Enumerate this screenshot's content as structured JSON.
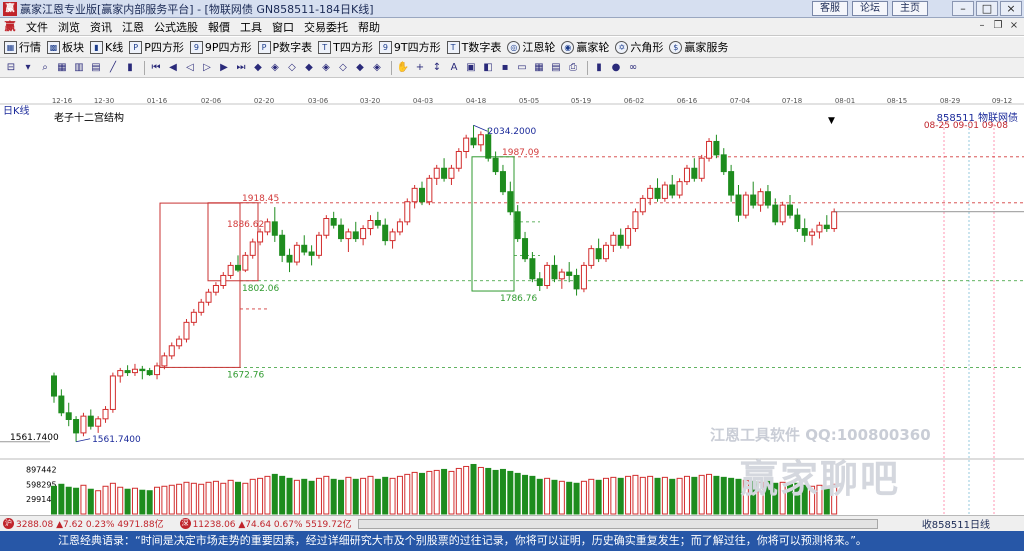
{
  "window": {
    "title": "赢家江恩专业版[赢家内部服务平台] - [物联网债  GN858511-184日K线]",
    "links": [
      "客服",
      "论坛",
      "主页"
    ]
  },
  "menu": [
    "文件",
    "浏览",
    "资讯",
    "江恩",
    "公式选股",
    "報價",
    "工具",
    "窗口",
    "交易委托",
    "帮助"
  ],
  "toolbar": {
    "buttons": [
      {
        "label": "行情",
        "icon": "grid-icon"
      },
      {
        "label": "板块",
        "icon": "blocks-icon"
      },
      {
        "label": "K线",
        "icon": "candle-icon"
      },
      {
        "label": "P四方形",
        "icon": "square-p-icon"
      },
      {
        "label": "9P四方形",
        "icon": "square-9p-icon"
      },
      {
        "label": "P数字表",
        "icon": "table-p-icon"
      },
      {
        "label": "T四方形",
        "icon": "square-t-icon"
      },
      {
        "label": "9T四方形",
        "icon": "square-9t-icon"
      },
      {
        "label": "T数字表",
        "icon": "table-t-icon"
      },
      {
        "label": "江恩轮",
        "icon": "wheel-icon"
      },
      {
        "label": "赢家轮",
        "icon": "winner-wheel-icon"
      },
      {
        "label": "六角形",
        "icon": "hexagon-icon"
      },
      {
        "label": "赢家服务",
        "icon": "dollar-icon"
      }
    ]
  },
  "chart": {
    "period": "日K线",
    "title": "老子十二宫结构",
    "code": "858511  物联网债",
    "future_dates": "08-25 09-01 09-08",
    "watermark": "江恩工具软件  QQ:100800360",
    "watermark_big": "赢家聊吧"
  },
  "chart_data": {
    "type": "candlestick",
    "x_ticks": [
      "12-16",
      "12-30",
      "01-16",
      "02-06",
      "02-20",
      "03-06",
      "03-20",
      "04-03",
      "04-18",
      "05-05",
      "05-19",
      "06-02",
      "06-16",
      "07-04",
      "07-18",
      "08-01",
      "08-15",
      "08-29",
      "09-12"
    ],
    "price_labels": {
      "high": "2034.2000",
      "low": "1561.7400",
      "left_axis": "1561.7400",
      "levels": [
        "1987.09",
        "1918.45",
        "1886.62",
        "1802.06",
        "1786.76",
        "1672.76"
      ]
    },
    "volume_axis_labels": [
      "897442",
      "598295",
      "299147"
    ],
    "ohlc": [
      [
        1660,
        1665,
        1620,
        1630
      ],
      [
        1630,
        1640,
        1600,
        1605
      ],
      [
        1605,
        1620,
        1585,
        1595
      ],
      [
        1595,
        1600,
        1561.74,
        1575
      ],
      [
        1575,
        1605,
        1570,
        1600
      ],
      [
        1600,
        1610,
        1580,
        1585
      ],
      [
        1585,
        1600,
        1575,
        1596
      ],
      [
        1596,
        1615,
        1590,
        1610
      ],
      [
        1610,
        1665,
        1605,
        1660
      ],
      [
        1660,
        1672,
        1650,
        1668
      ],
      [
        1668,
        1676,
        1660,
        1665
      ],
      [
        1665,
        1678,
        1660,
        1670
      ],
      [
        1670,
        1675,
        1655,
        1668
      ],
      [
        1668,
        1672,
        1660,
        1662
      ],
      [
        1662,
        1680,
        1655,
        1675
      ],
      [
        1675,
        1695,
        1670,
        1690
      ],
      [
        1690,
        1710,
        1685,
        1705
      ],
      [
        1705,
        1720,
        1700,
        1715
      ],
      [
        1715,
        1745,
        1710,
        1740
      ],
      [
        1740,
        1760,
        1735,
        1755
      ],
      [
        1755,
        1775,
        1750,
        1770
      ],
      [
        1770,
        1790,
        1765,
        1785
      ],
      [
        1785,
        1800,
        1780,
        1795
      ],
      [
        1795,
        1815,
        1790,
        1810
      ],
      [
        1810,
        1830,
        1805,
        1825
      ],
      [
        1825,
        1840,
        1815,
        1818
      ],
      [
        1818,
        1845,
        1815,
        1840
      ],
      [
        1840,
        1865,
        1835,
        1860
      ],
      [
        1860,
        1880,
        1855,
        1875
      ],
      [
        1875,
        1895,
        1870,
        1890
      ],
      [
        1890,
        1912,
        1860,
        1870
      ],
      [
        1870,
        1878,
        1830,
        1840
      ],
      [
        1840,
        1850,
        1815,
        1830
      ],
      [
        1830,
        1860,
        1825,
        1855
      ],
      [
        1855,
        1870,
        1840,
        1845
      ],
      [
        1845,
        1855,
        1825,
        1840
      ],
      [
        1840,
        1875,
        1835,
        1870
      ],
      [
        1870,
        1900,
        1865,
        1895
      ],
      [
        1895,
        1905,
        1880,
        1885
      ],
      [
        1885,
        1895,
        1860,
        1865
      ],
      [
        1865,
        1880,
        1845,
        1875
      ],
      [
        1875,
        1890,
        1860,
        1865
      ],
      [
        1865,
        1885,
        1855,
        1880
      ],
      [
        1880,
        1900,
        1870,
        1892
      ],
      [
        1892,
        1905,
        1880,
        1885
      ],
      [
        1885,
        1895,
        1855,
        1862
      ],
      [
        1862,
        1880,
        1850,
        1875
      ],
      [
        1875,
        1895,
        1870,
        1890
      ],
      [
        1890,
        1925,
        1885,
        1920
      ],
      [
        1920,
        1945,
        1910,
        1940
      ],
      [
        1940,
        1950,
        1915,
        1920
      ],
      [
        1920,
        1960,
        1915,
        1955
      ],
      [
        1955,
        1975,
        1945,
        1970
      ],
      [
        1970,
        1985,
        1950,
        1955
      ],
      [
        1955,
        1975,
        1945,
        1970
      ],
      [
        1970,
        2000,
        1965,
        1995
      ],
      [
        1995,
        2020,
        1985,
        2015
      ],
      [
        2015,
        2034.2,
        2000,
        2005
      ],
      [
        2005,
        2025,
        1995,
        2020
      ],
      [
        2020,
        2030,
        1980,
        1985
      ],
      [
        1985,
        1995,
        1960,
        1965
      ],
      [
        1965,
        1975,
        1930,
        1935
      ],
      [
        1935,
        1950,
        1900,
        1905
      ],
      [
        1905,
        1915,
        1860,
        1865
      ],
      [
        1865,
        1875,
        1830,
        1835
      ],
      [
        1835,
        1845,
        1800,
        1805
      ],
      [
        1805,
        1815,
        1786.76,
        1795
      ],
      [
        1795,
        1830,
        1790,
        1825
      ],
      [
        1825,
        1840,
        1800,
        1805
      ],
      [
        1805,
        1820,
        1790,
        1815
      ],
      [
        1815,
        1830,
        1800,
        1810
      ],
      [
        1810,
        1820,
        1780,
        1790
      ],
      [
        1790,
        1830,
        1785,
        1825
      ],
      [
        1825,
        1855,
        1820,
        1850
      ],
      [
        1850,
        1865,
        1830,
        1835
      ],
      [
        1835,
        1860,
        1830,
        1855
      ],
      [
        1855,
        1875,
        1845,
        1870
      ],
      [
        1870,
        1880,
        1850,
        1855
      ],
      [
        1855,
        1885,
        1850,
        1880
      ],
      [
        1880,
        1910,
        1875,
        1905
      ],
      [
        1905,
        1930,
        1900,
        1925
      ],
      [
        1925,
        1945,
        1915,
        1940
      ],
      [
        1940,
        1955,
        1920,
        1925
      ],
      [
        1925,
        1950,
        1920,
        1945
      ],
      [
        1945,
        1960,
        1925,
        1930
      ],
      [
        1930,
        1955,
        1925,
        1950
      ],
      [
        1950,
        1975,
        1945,
        1970
      ],
      [
        1970,
        1985,
        1950,
        1955
      ],
      [
        1955,
        1990,
        1950,
        1985
      ],
      [
        1985,
        2015,
        1980,
        2010
      ],
      [
        2010,
        2020,
        1985,
        1990
      ],
      [
        1990,
        2000,
        1960,
        1965
      ],
      [
        1965,
        1975,
        1920,
        1930
      ],
      [
        1930,
        1945,
        1890,
        1900
      ],
      [
        1900,
        1935,
        1895,
        1930
      ],
      [
        1930,
        1950,
        1910,
        1915
      ],
      [
        1915,
        1940,
        1905,
        1935
      ],
      [
        1935,
        1945,
        1910,
        1915
      ],
      [
        1915,
        1925,
        1885,
        1890
      ],
      [
        1890,
        1920,
        1885,
        1915
      ],
      [
        1915,
        1930,
        1895,
        1900
      ],
      [
        1900,
        1910,
        1875,
        1880
      ],
      [
        1880,
        1895,
        1860,
        1870
      ],
      [
        1870,
        1880,
        1855,
        1875
      ],
      [
        1875,
        1890,
        1865,
        1885
      ],
      [
        1885,
        1900,
        1875,
        1880
      ],
      [
        1880,
        1910,
        1875,
        1905
      ]
    ],
    "volume": [
      560000,
      600000,
      540000,
      520000,
      580000,
      500000,
      470000,
      560000,
      620000,
      540000,
      500000,
      520000,
      480000,
      470000,
      540000,
      560000,
      580000,
      600000,
      640000,
      620000,
      600000,
      640000,
      660000,
      620000,
      680000,
      640000,
      620000,
      700000,
      720000,
      760000,
      800000,
      760000,
      720000,
      680000,
      700000,
      660000,
      720000,
      760000,
      700000,
      680000,
      740000,
      700000,
      720000,
      760000,
      700000,
      740000,
      720000,
      760000,
      800000,
      840000,
      820000,
      860000,
      880000,
      900000,
      860000,
      920000,
      960000,
      1000000,
      940000,
      920000,
      880000,
      900000,
      860000,
      820000,
      780000,
      760000,
      700000,
      720000,
      680000,
      660000,
      640000,
      620000,
      660000,
      700000,
      680000,
      720000,
      740000,
      720000,
      760000,
      780000,
      740000,
      760000,
      720000,
      740000,
      700000,
      720000,
      760000,
      740000,
      780000,
      800000,
      760000,
      740000,
      720000,
      700000,
      680000,
      660000,
      640000,
      660000,
      620000,
      640000,
      600000,
      620000,
      580000,
      560000,
      580000,
      560000,
      600000
    ]
  },
  "status": {
    "index1": "3288.08 ▲7.62 0.23% 4971.88亿",
    "index2": "11238.06 ▲74.64 0.67% 5519.72亿",
    "right": "收858511日线"
  },
  "quote": "江恩经典语录：“时间是决定市场走势的重要因素，经过详细研究大市及个别股票的过往记录，你将可以证明，历史确实重复发生；而了解过往，你将可以预测将来。”。"
}
